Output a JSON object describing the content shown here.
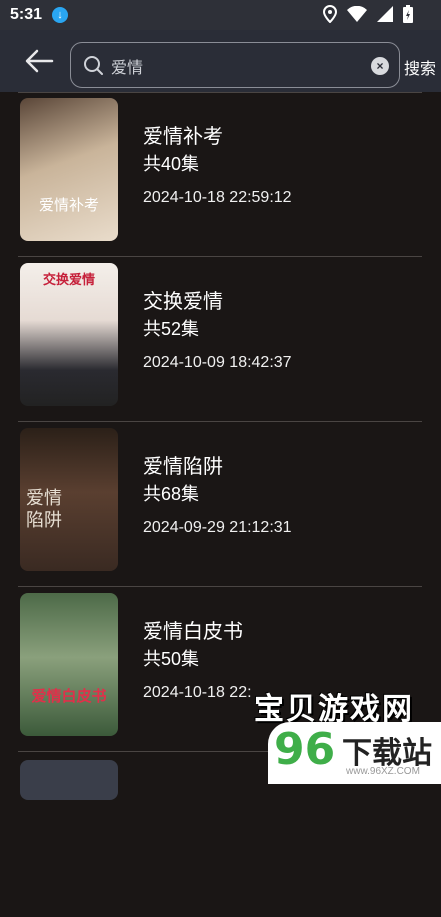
{
  "status_bar": {
    "time": "5:31"
  },
  "search": {
    "value": "爱情",
    "button_label": "搜索"
  },
  "results": [
    {
      "title": "爱情补考",
      "episodes": "共40集",
      "date": "2024-10-18 22:59:12",
      "cover_text": "爱情补考",
      "cover_color": "#c9b49a"
    },
    {
      "title": "交换爱情",
      "episodes": "共52集",
      "date": "2024-10-09 18:42:37",
      "cover_text": "交换爱情",
      "cover_color": "#f1ebe6"
    },
    {
      "title": "爱情陷阱",
      "episodes": "共68集",
      "date": "2024-09-29 21:12:31",
      "cover_text": "爱情陷阱",
      "cover_color": "#3a2a22"
    },
    {
      "title": "爱情白皮书",
      "episodes": "共50集",
      "date": "2024-10-18 22:",
      "cover_text": "爱情白皮书",
      "cover_color": "#5f7a55"
    }
  ],
  "watermark": {
    "text": "宝贝游戏网",
    "logo_number": "96",
    "logo_text": "下载站",
    "logo_url": "www.96XZ.COM"
  }
}
